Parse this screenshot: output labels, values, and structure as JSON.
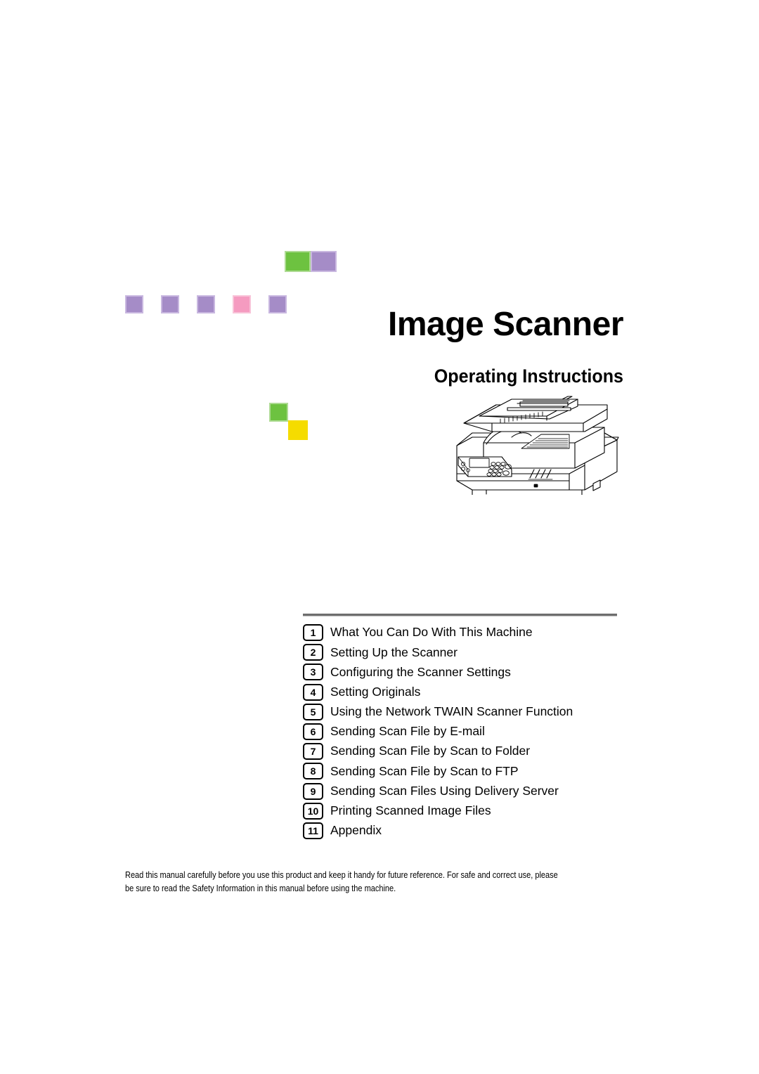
{
  "cover": {
    "title": "Image Scanner",
    "subtitle": "Operating Instructions",
    "illustration_name": "multifunction-scanner-illustration"
  },
  "chapters": [
    {
      "number": "1",
      "label": "What You Can Do With This Machine"
    },
    {
      "number": "2",
      "label": "Setting Up the Scanner"
    },
    {
      "number": "3",
      "label": "Configuring the Scanner Settings"
    },
    {
      "number": "4",
      "label": "Setting Originals"
    },
    {
      "number": "5",
      "label": "Using the Network TWAIN Scanner Function"
    },
    {
      "number": "6",
      "label": "Sending Scan File by E-mail"
    },
    {
      "number": "7",
      "label": "Sending Scan File by Scan to Folder"
    },
    {
      "number": "8",
      "label": "Sending Scan File by Scan to FTP"
    },
    {
      "number": "9",
      "label": "Sending Scan Files Using Delivery Server"
    },
    {
      "number": "10",
      "label": "Printing Scanned Image Files"
    },
    {
      "number": "11",
      "label": "Appendix"
    }
  ],
  "footer": {
    "note": "Read this manual carefully before you use this product and keep it handy for future reference. For safe and correct use, please be sure to read the Safety Information in this manual before using the machine."
  },
  "decor": {
    "colors": {
      "purple": "#A58CC7",
      "purple_edge": "#C9B8E0",
      "pink": "#F59BC0",
      "pink_edge": "#F8C3D8",
      "green": "#6DC240",
      "green_edge": "#AEDB93",
      "yellow": "#F5DC00"
    },
    "top_pair": [
      "green",
      "purple"
    ],
    "row": [
      "purple",
      "purple",
      "purple",
      "pink",
      "purple"
    ],
    "lower_pair": [
      "green",
      "yellow"
    ]
  }
}
